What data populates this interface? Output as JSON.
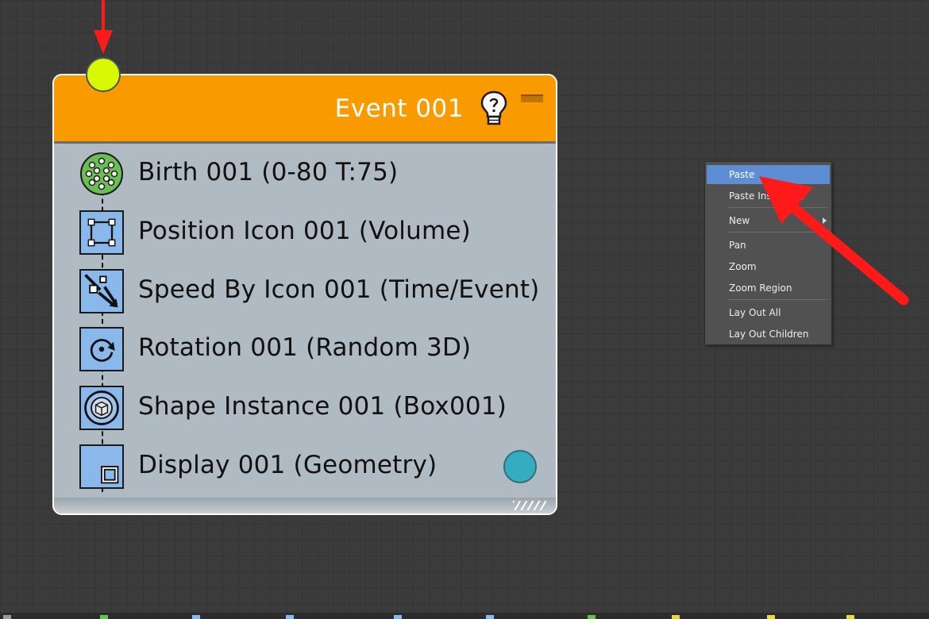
{
  "node": {
    "title": "Event 001",
    "title_icon": "light-bulb-icon",
    "header_color": "#f99a00",
    "operators": [
      {
        "label": "Birth 001 (0-80 T:75)",
        "icon": "birth-icon"
      },
      {
        "label": "Position Icon 001 (Volume)",
        "icon": "position-icon"
      },
      {
        "label": "Speed By Icon 001 (Time/Event)",
        "icon": "speed-by-icon"
      },
      {
        "label": "Rotation 001 (Random 3D)",
        "icon": "rotation-icon"
      },
      {
        "label": "Shape Instance 001 (Box001)",
        "icon": "shape-instance-icon"
      },
      {
        "label": "Display 001 (Geometry)",
        "icon": "display-icon"
      }
    ]
  },
  "context_menu": {
    "items": [
      {
        "label": "Paste",
        "highlighted": true
      },
      {
        "label": "Paste Instanced"
      },
      {
        "label": "New",
        "submenu": true
      },
      {
        "label": "Pan"
      },
      {
        "label": "Zoom"
      },
      {
        "label": "Zoom Region"
      },
      {
        "label": "Lay Out All"
      },
      {
        "label": "Lay Out Children"
      }
    ],
    "highlight_color": "#5d8ed3"
  },
  "colors": {
    "input_socket": "#d8fa00",
    "output_socket": "#35adc0",
    "annotation_arrow": "#ff0000"
  }
}
